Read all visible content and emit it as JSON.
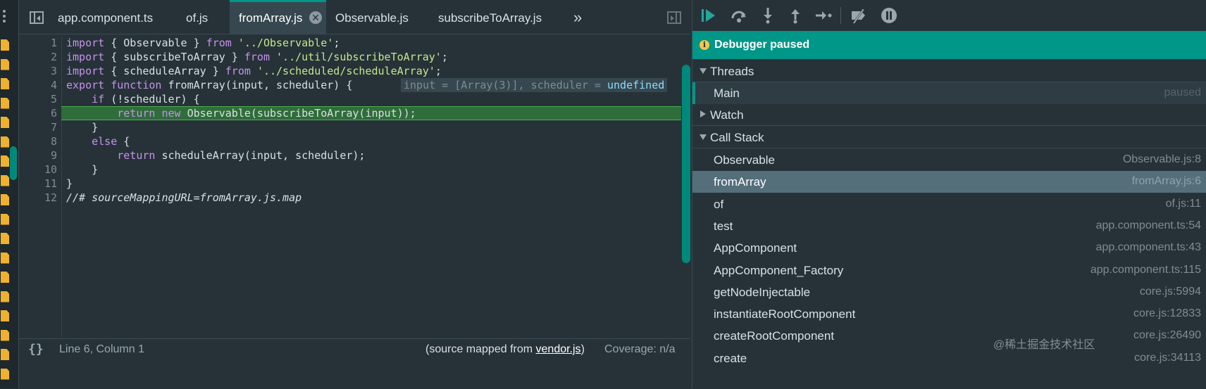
{
  "tabs": [
    {
      "label": "app.component.ts"
    },
    {
      "label": "of.js"
    },
    {
      "label": "fromArray.js",
      "active": true
    },
    {
      "label": "Observable.js"
    },
    {
      "label": "subscribeToArray.js"
    }
  ],
  "tab_overflow": "»",
  "tab_close_glyph": "✕",
  "code": {
    "lines": [
      {
        "n": "1",
        "text": "import { Observable } from '../Observable';"
      },
      {
        "n": "2",
        "text": "import { subscribeToArray } from '../util/subscribeToArray';"
      },
      {
        "n": "3",
        "text": "import { scheduleArray } from '../scheduled/scheduleArray';"
      },
      {
        "n": "4",
        "text": "export function fromArray(input, scheduler) {"
      },
      {
        "n": "5",
        "text": "    if (!scheduler) {"
      },
      {
        "n": "6",
        "text": "        return new Observable(subscribeToArray(input));"
      },
      {
        "n": "7",
        "text": "    }"
      },
      {
        "n": "8",
        "text": "    else {"
      },
      {
        "n": "9",
        "text": "        return scheduleArray(input, scheduler);"
      },
      {
        "n": "10",
        "text": "    }"
      },
      {
        "n": "11",
        "text": "}"
      },
      {
        "n": "12",
        "text": "//# sourceMappingURL=fromArray.js.map"
      }
    ],
    "inline_value_prefix": "input = [Array(3)], scheduler = ",
    "inline_value_undefined": "undefined"
  },
  "status": {
    "braces": "{}",
    "position": "Line 6, Column 1",
    "mapped_prefix": "(source mapped from ",
    "mapped_link": "vendor.js",
    "mapped_suffix": ")",
    "coverage": "Coverage: n/a"
  },
  "debugger": {
    "paused_label": "Debugger paused",
    "info_glyph": "i",
    "threads_title": "Threads",
    "thread_name": "Main",
    "thread_status": "paused",
    "watch_title": "Watch",
    "callstack_title": "Call Stack",
    "frames": [
      {
        "name": "Observable",
        "loc": "Observable.js:8"
      },
      {
        "name": "fromArray",
        "loc": "fromArray.js:6",
        "selected": true
      },
      {
        "name": "of",
        "loc": "of.js:11"
      },
      {
        "name": "test",
        "loc": "app.component.ts:54"
      },
      {
        "name": "AppComponent",
        "loc": "app.component.ts:43"
      },
      {
        "name": "AppComponent_Factory",
        "loc": "app.component.ts:115"
      },
      {
        "name": "getNodeInjectable",
        "loc": "core.js:5994"
      },
      {
        "name": "instantiateRootComponent",
        "loc": "core.js:12833"
      },
      {
        "name": "createRootComponent",
        "loc": "core.js:26490"
      },
      {
        "name": "create",
        "loc": "core.js:34113"
      }
    ]
  },
  "watermark": "@稀土掘金技术社区",
  "colors": {
    "accent": "#009688",
    "exec_line": "#2f6d3a",
    "file_icon": "#f0b12e",
    "background": "#263238"
  }
}
